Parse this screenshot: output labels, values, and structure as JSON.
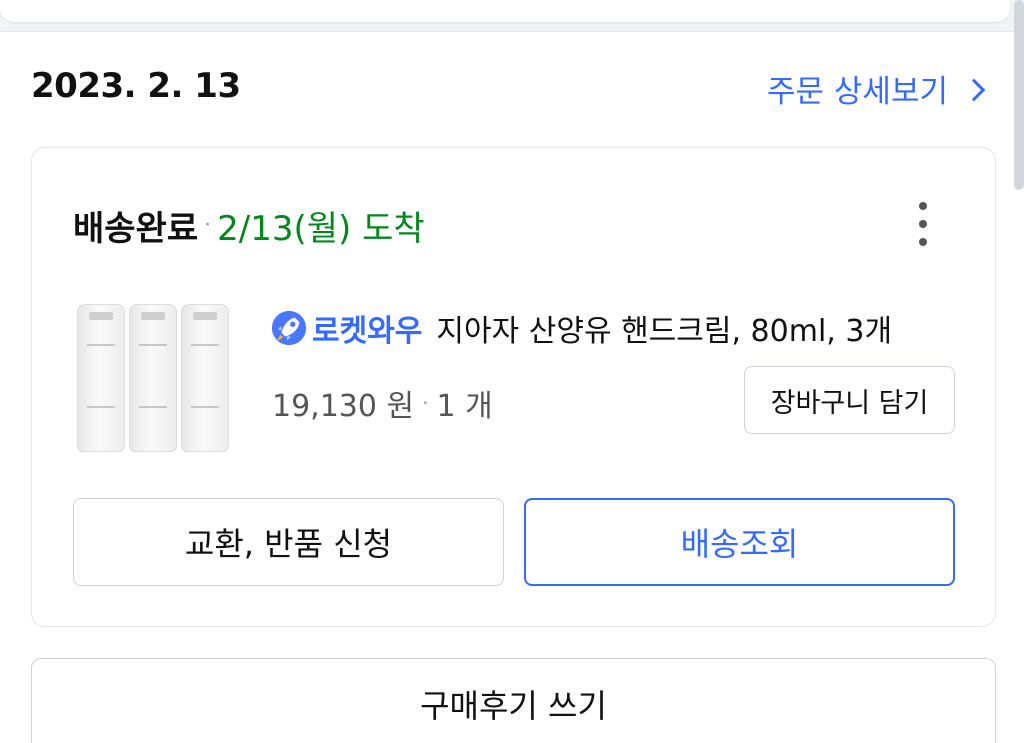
{
  "order": {
    "date": "2023. 2. 13",
    "detail_link_label": "주문 상세보기"
  },
  "shipment": {
    "status": "배송완료",
    "separator": "·",
    "arrival": "2/13(월) 도착"
  },
  "product": {
    "badge_label": "로켓와우",
    "name": "지아자 산양유 핸드크림, 80ml, 3개",
    "price": "19,130 원",
    "separator": "·",
    "quantity": "1 개",
    "cart_button_label": "장바구니 담기"
  },
  "actions": {
    "exchange_label": "교환, 반품 신청",
    "tracking_label": "배송조회",
    "review_label": "구매후기 쓰기"
  },
  "icons": {
    "badge": "rocket-icon",
    "more": "more-vertical-icon",
    "detail_arrow": "chevron-right-icon"
  },
  "colors": {
    "accent": "#346aff",
    "arrival": "#00891a",
    "border": "#cfd3d8"
  }
}
